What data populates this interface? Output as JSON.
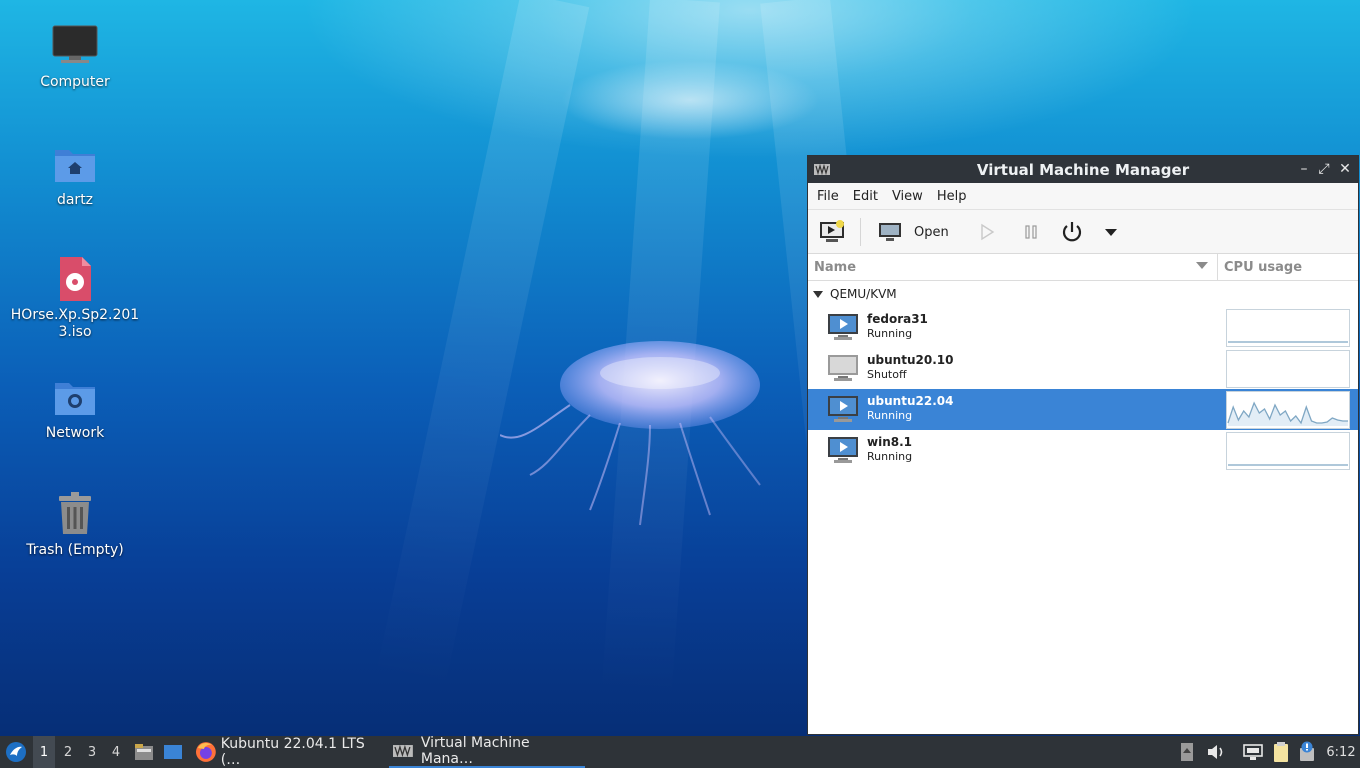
{
  "desktop": {
    "icons": [
      {
        "label": "Computer",
        "icon": "computer-icon"
      },
      {
        "label": "dartz",
        "icon": "home-folder-icon"
      },
      {
        "label": "HOrse.Xp.Sp2.2013.iso",
        "icon": "disc-image-icon"
      },
      {
        "label": "Network",
        "icon": "network-folder-icon"
      },
      {
        "label": "Trash (Empty)",
        "icon": "trash-icon"
      }
    ]
  },
  "window": {
    "title": "Virtual Machine Manager",
    "menu": [
      "File",
      "Edit",
      "View",
      "Help"
    ],
    "toolbar": {
      "new_vm_icon": "new-vm-icon",
      "open_label": "Open",
      "run_icon": "play-icon",
      "pause_icon": "pause-icon",
      "shutdown_icon": "power-icon",
      "menu_icon": "dropdown-arrow-icon"
    },
    "columns": {
      "name": "Name",
      "cpu": "CPU usage"
    },
    "group": "QEMU/KVM",
    "vms": [
      {
        "name": "fedora31",
        "status": "Running",
        "selected": false,
        "state": "running",
        "cpu": []
      },
      {
        "name": "ubuntu20.10",
        "status": "Shutoff",
        "selected": false,
        "state": "shutoff",
        "cpu": []
      },
      {
        "name": "ubuntu22.04",
        "status": "Running",
        "selected": true,
        "state": "running",
        "cpu": [
          2,
          18,
          5,
          14,
          8,
          22,
          12,
          16,
          6,
          20,
          10,
          14,
          4,
          9,
          2,
          18,
          4,
          2,
          2,
          3,
          7,
          5,
          4,
          4
        ]
      },
      {
        "name": "win8.1",
        "status": "Running",
        "selected": false,
        "state": "running",
        "cpu": []
      }
    ],
    "colors": {
      "selection": "#3a84d6",
      "graph_line": "#7fa7c4"
    }
  },
  "taskbar": {
    "workspaces": [
      "1",
      "2",
      "3",
      "4"
    ],
    "active_workspace": "1",
    "tasks": [
      {
        "label": "Kubuntu 22.04.1 LTS (…",
        "icon": "firefox-icon"
      },
      {
        "label": "Virtual Machine Mana…",
        "icon": "vmm-icon"
      }
    ],
    "clock": "6:12"
  }
}
